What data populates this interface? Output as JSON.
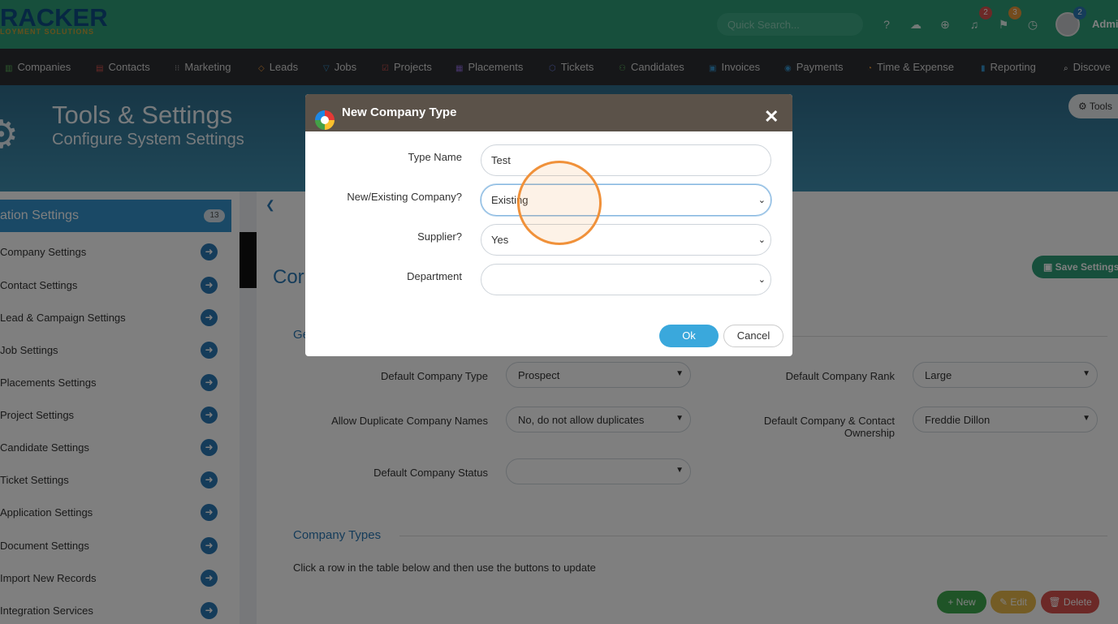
{
  "header": {
    "logo_line1": "RACKER",
    "logo_line2": "LOYMENT SOLUTIONS",
    "search_placeholder": "Quick Search...",
    "notifications_count": "2",
    "flags_count": "3",
    "messages_count": "2",
    "user_name": "Admi",
    "icons": [
      "help-icon",
      "chat-icon",
      "add-icon",
      "bell-icon",
      "flag-icon",
      "history-icon"
    ]
  },
  "nav": {
    "items": [
      "Companies",
      "Contacts",
      "Marketing",
      "Leads",
      "Jobs",
      "Projects",
      "Placements",
      "Tickets",
      "Candidates",
      "Invoices",
      "Payments",
      "Time & Expense",
      "Reporting",
      "Discove"
    ]
  },
  "hero": {
    "title": "Tools & Settings",
    "subtitle": "Configure System Settings",
    "tools_button": "Tools"
  },
  "sidebar": {
    "title": "ation Settings",
    "count": "13",
    "items": [
      "Company Settings",
      "Contact Settings",
      "Lead & Campaign Settings",
      "Job Settings",
      "Placements Settings",
      "Project Settings",
      "Candidate Settings",
      "Ticket Settings",
      "Application Settings",
      "Document Settings",
      "Import New Records",
      "Integration Services"
    ]
  },
  "main": {
    "title": "Cor",
    "save_button": "Save Settings",
    "general_heading": "Ge",
    "fields": {
      "default_company_type_label": "Default Company Type",
      "default_company_type_value": "Prospect",
      "default_company_rank_label": "Default Company Rank",
      "default_company_rank_value": "Large",
      "allow_duplicate_label": "Allow Duplicate Company Names",
      "allow_duplicate_value": "No, do not allow duplicates",
      "ownership_label_1": "Default Company & Contact",
      "ownership_label_2": "Ownership",
      "ownership_value": "Freddie Dillon",
      "default_status_label": "Default Company Status",
      "default_status_value": ""
    },
    "company_types_heading": "Company Types",
    "company_types_hint": "Click a row in the table below and then use the buttons to update",
    "new_button": "+ New",
    "edit_button": "✎ Edit",
    "delete_button": "🗑 Delete"
  },
  "modal": {
    "title": "New Company Type",
    "type_name_label": "Type Name",
    "type_name_value": "Test",
    "new_existing_label": "New/Existing Company?",
    "new_existing_value": "Existing",
    "supplier_label": "Supplier?",
    "supplier_value": "Yes",
    "department_label": "Department",
    "department_value": "",
    "ok_button": "Ok",
    "cancel_button": "Cancel"
  },
  "colors": {
    "topbar": "#2e9e78",
    "navbar": "#2d2f33",
    "accent_blue": "#3593cc",
    "ok_button": "#3aa8dc",
    "cursor_highlight": "#f0913a"
  }
}
